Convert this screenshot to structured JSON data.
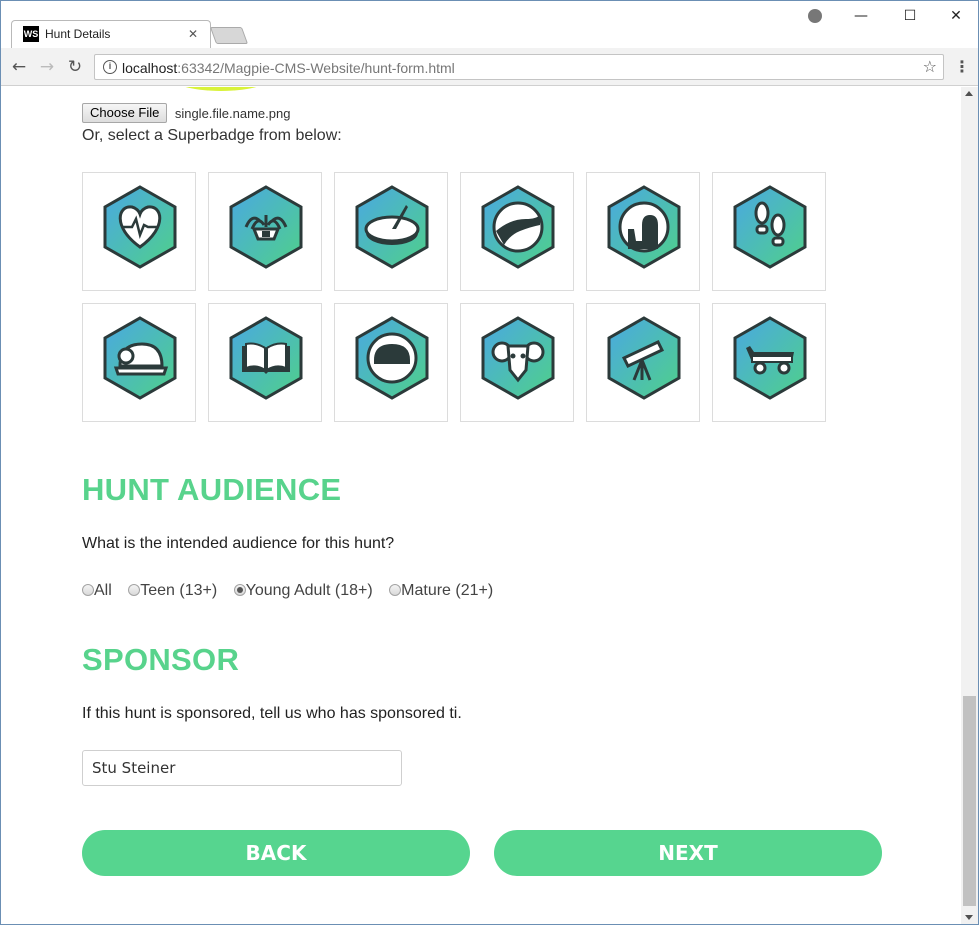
{
  "browser": {
    "tab_title": "Hunt Details",
    "tab_favicon_text": "WS",
    "url_host": "localhost",
    "url_rest": ":63342/Magpie-CMS-Website/hunt-form.html"
  },
  "upload": {
    "choose_label": "Choose File",
    "file_name": "single.file.name.png",
    "select_text": "Or, select a Superbadge from below:"
  },
  "badges": [
    "heart-monitor",
    "fountain",
    "sundial",
    "river-road",
    "fireplace",
    "footprints",
    "mining-helmet",
    "open-book",
    "space-helmet",
    "ram-skull",
    "telescope",
    "wagon"
  ],
  "audience": {
    "heading": "HUNT AUDIENCE",
    "question": "What is the intended audience for this hunt?",
    "options": [
      "All",
      "Teen (13+)",
      "Young Adult (18+)",
      "Mature (21+)"
    ],
    "selected": "Young Adult (18+)"
  },
  "sponsor": {
    "heading": "SPONSOR",
    "question": "If this hunt is sponsored, tell us who has sponsored ti.",
    "value": "Stu Steiner"
  },
  "buttons": {
    "back": "BACK",
    "next": "NEXT"
  },
  "colors": {
    "accent": "#56d58f",
    "heading": "#58d38c",
    "badge_top": "#4aa8e2",
    "badge_bottom": "#4fd08a",
    "badge_outline": "#2b3a3a"
  }
}
